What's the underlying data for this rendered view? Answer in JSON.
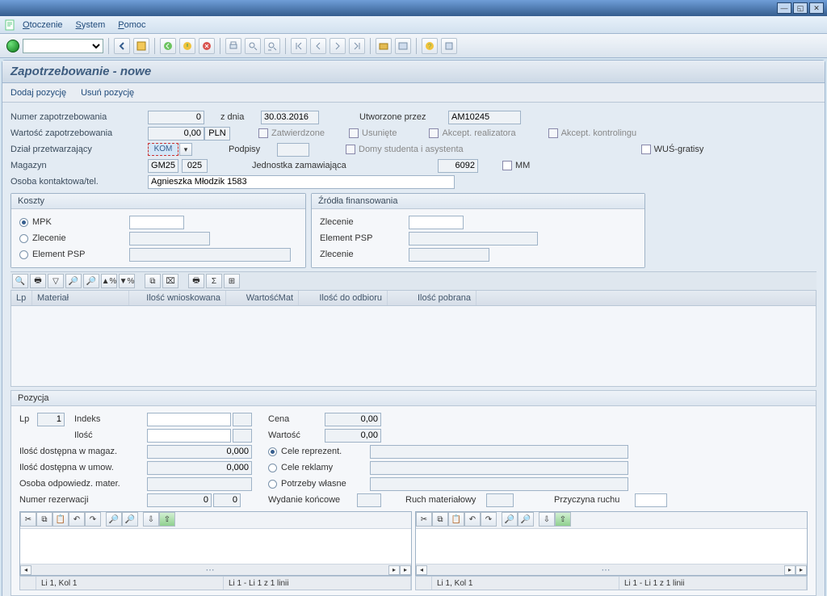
{
  "menu": {
    "otoczenie": "Otoczenie",
    "system": "System",
    "pomoc": "Pomoc"
  },
  "page_title": "Zapotrzebowanie - nowe",
  "app_toolbar": {
    "add": "Dodaj pozycję",
    "del": "Usuń pozycję"
  },
  "header": {
    "numer_label": "Numer zapotrzebowania",
    "numer": "0",
    "zdnia_label": "z dnia",
    "zdnia": "30.03.2016",
    "utworzone_label": "Utworzone przez",
    "utworzone": "AM10245",
    "wartosc_label": "Wartość zapotrzebowania",
    "wartosc": "0,00",
    "waluta": "PLN",
    "zatwierdzone": "Zatwierdzone",
    "usuniete": "Usunięte",
    "akc_real": "Akcept. realizatora",
    "akc_kontr": "Akcept. kontrolingu",
    "dzial_label": "Dział przetwarzający",
    "dzial": "KOM",
    "podpisy": "Podpisy",
    "domy": "Domy studenta i asystenta",
    "wus": "WUŚ-gratisy",
    "magazyn_label": "Magazyn",
    "magazyn1": "GM25",
    "magazyn2": "025",
    "jednostka_label": "Jednostka zamawiająca",
    "jednostka": "6092",
    "mm": "MM",
    "osoba_label": "Osoba kontaktowa/tel.",
    "osoba": "Agnieszka Młodzik 1583"
  },
  "koszty": {
    "title": "Koszty",
    "mpk": "MPK",
    "zlecenie": "Zlecenie",
    "psp": "Element PSP"
  },
  "zrodla": {
    "title": "Źródła finansowania",
    "zlecenie": "Zlecenie",
    "psp": "Element PSP",
    "zlecenie2": "Zlecenie"
  },
  "table": {
    "cols": {
      "lp": "Lp",
      "material": "Materiał",
      "ilosc_wn": "Ilość wnioskowana",
      "wartmat": "WartośćMat",
      "ilosc_odb": "Ilość do odbioru",
      "ilosc_pob": "Ilość pobrana"
    }
  },
  "pozycja": {
    "title": "Pozycja",
    "lp_label": "Lp",
    "lp": "1",
    "indeks_label": "Indeks",
    "cena_label": "Cena",
    "cena": "0,00",
    "ilosc_label": "Ilość",
    "wartosc_label": "Wartość",
    "wartosc": "0,00",
    "dost_mag_label": "Ilość dostępna w magaz.",
    "dost_mag": "0,000",
    "cele_rep": "Cele reprezent.",
    "dost_umow_label": "Ilość dostępna w umow.",
    "dost_umow": "0,000",
    "cele_rek": "Cele reklamy",
    "osoba_odp_label": "Osoba odpowiedz. mater.",
    "potrzeby": "Potrzeby własne",
    "numer_rez_label": "Numer rezerwacji",
    "rez1": "0",
    "rez2": "0",
    "wydanie_label": "Wydanie końcowe",
    "ruch_label": "Ruch materiałowy",
    "przyczyna_label": "Przyczyna ruchu"
  },
  "statusbar": {
    "pos": "Li 1, Kol 1",
    "range": "Li 1 - Li 1 z 1 linii"
  }
}
